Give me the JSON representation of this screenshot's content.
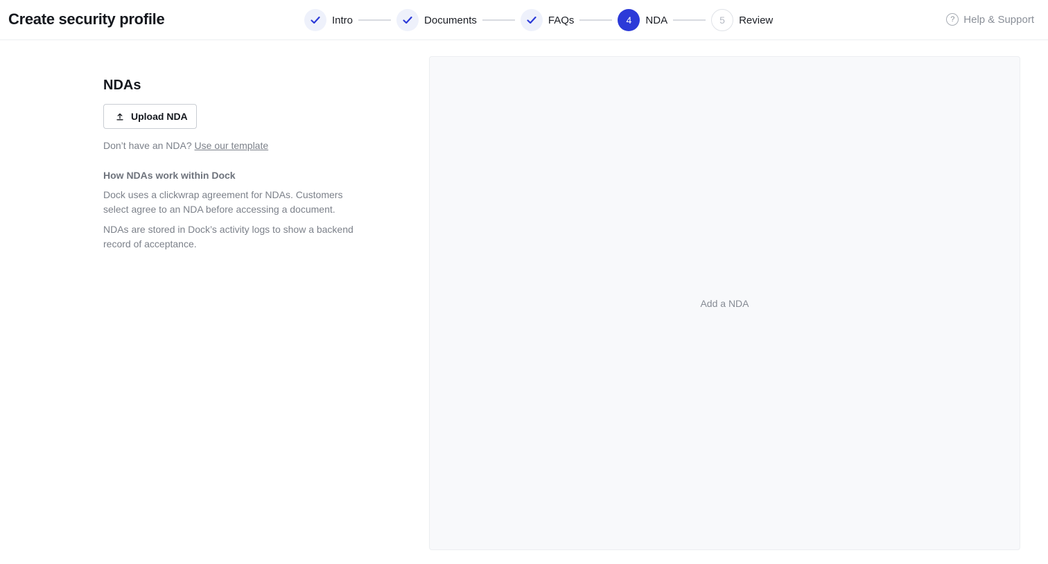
{
  "header": {
    "title": "Create security profile",
    "help_label": "Help & Support",
    "help_icon_glyph": "?"
  },
  "stepper": {
    "steps": [
      {
        "number": "1",
        "label": "Intro",
        "state": "done"
      },
      {
        "number": "2",
        "label": "Documents",
        "state": "done"
      },
      {
        "number": "3",
        "label": "FAQs",
        "state": "done"
      },
      {
        "number": "4",
        "label": "NDA",
        "state": "current"
      },
      {
        "number": "5",
        "label": "Review",
        "state": "todo"
      }
    ]
  },
  "main": {
    "section_title": "NDAs",
    "upload_button": "Upload NDA",
    "template_prompt": "Don’t have an NDA?",
    "template_link": "Use our template",
    "how_title": "How NDAs work within Dock",
    "paragraph_1": "Dock uses a clickwrap agreement for NDAs. Customers select agree to an NDA before accessing a document.",
    "paragraph_2": "NDAs are stored in Dock’s activity logs to show a backend record of acceptance."
  },
  "preview": {
    "placeholder": "Add a NDA"
  },
  "colors": {
    "accent": "#2c3ad8",
    "check": "#2c3ad8",
    "done_bg": "#eef1fb"
  }
}
